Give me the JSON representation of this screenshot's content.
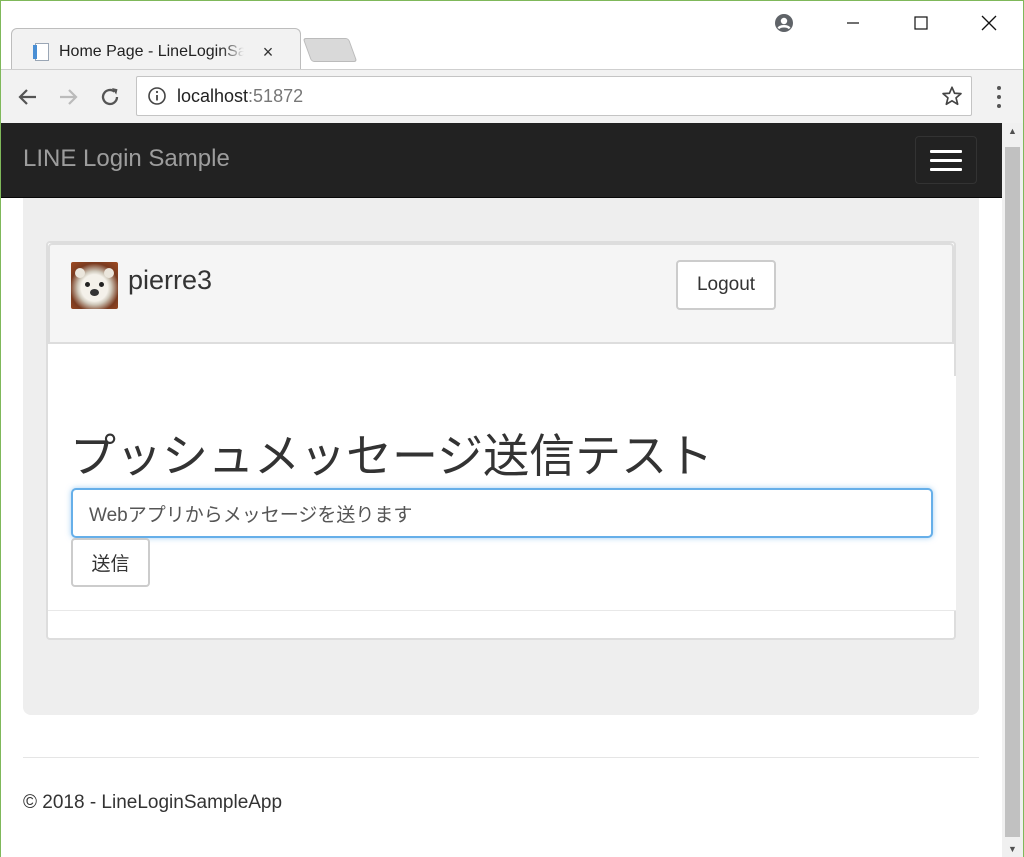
{
  "browser": {
    "tab_title": "Home Page - LineLoginSampleApp",
    "tab_close": "×",
    "url_host": "localhost",
    "url_port": ":51872",
    "window_minimize": "—",
    "window_maximize": "☐",
    "window_close": "✕"
  },
  "navbar": {
    "brand": "LINE Login Sample"
  },
  "profile": {
    "username": "pierre3",
    "logout_label": "Logout"
  },
  "push": {
    "title": "プッシュメッセージ送信テスト",
    "input_value": "Webアプリからメッセージを送ります",
    "send_label": "送信"
  },
  "footer": {
    "text": "© 2018 - LineLoginSampleApp"
  },
  "colors": {
    "navbar_bg": "#222222",
    "jumbotron_bg": "#eeeeee",
    "input_focus": "#66afe9",
    "window_border": "#7fb85a"
  }
}
